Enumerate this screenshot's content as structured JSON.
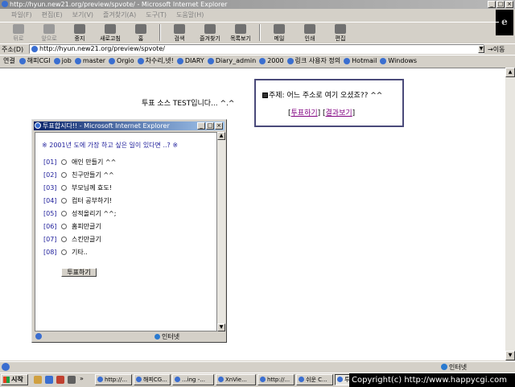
{
  "window": {
    "title": "http://hyun.new21.org/preview/spvote/ - Microsoft Internet Explorer"
  },
  "menu": [
    "파일(F)",
    "편집(E)",
    "보기(V)",
    "즐겨찾기(A)",
    "도구(T)",
    "도움말(H)"
  ],
  "toolbar": [
    {
      "label": "뒤로",
      "disabled": true
    },
    {
      "label": "앞으로",
      "disabled": true
    },
    {
      "label": "중지",
      "disabled": false
    },
    {
      "label": "새로고침",
      "disabled": false
    },
    {
      "label": "홈",
      "disabled": false
    },
    {
      "label": "검색",
      "disabled": false
    },
    {
      "label": "즐겨찾기",
      "disabled": false
    },
    {
      "label": "목록보기",
      "disabled": false
    },
    {
      "label": "메일",
      "disabled": false
    },
    {
      "label": "인쇄",
      "disabled": false
    },
    {
      "label": "편집",
      "disabled": false
    }
  ],
  "address": {
    "label": "주소(D)",
    "url": "http://hyun.new21.org/preview/spvote/",
    "go": "이동"
  },
  "links": {
    "label": "연결",
    "items": [
      "해피CGI",
      "job",
      "master",
      "Orgio",
      "차수리,넷!",
      "DIARY",
      "Diary_admin",
      "2000",
      "링크 사용자 정의",
      "Hotmail",
      "Windows"
    ]
  },
  "page": {
    "test_text": "투표 소스 TEST입니다... ^.^",
    "subject": "주제: 어느 주소로 여기 오셨죠?? ^^",
    "vote_link": "투표하기",
    "result_link": "결과보기"
  },
  "popup": {
    "title": "투표합시다!! - Microsoft Internet Explorer",
    "question": "※ 2001년 도에 가장 하고 싶은 일이 있다면 ..? ※",
    "options": [
      {
        "num": "[01]",
        "text": "애인 만들기 ^^"
      },
      {
        "num": "[02]",
        "text": "친구만들기 ^^"
      },
      {
        "num": "[03]",
        "text": "부모님께 효도!"
      },
      {
        "num": "[04]",
        "text": "컴터 공부하기!"
      },
      {
        "num": "[05]",
        "text": "성적올리기 ^^;"
      },
      {
        "num": "[06]",
        "text": "홈피만글기"
      },
      {
        "num": "[07]",
        "text": "스킨만글기"
      },
      {
        "num": "[08]",
        "text": "기타.."
      }
    ],
    "vote_button": "투표하기",
    "status_zone": "인터넷"
  },
  "status": {
    "zone": "인터넷"
  },
  "taskbar": {
    "start": "시작",
    "tasks": [
      "http://...",
      "해피CG...",
      "...ing -...",
      "XnVie...",
      "http://...",
      "쉬운 C...",
      "투표..."
    ],
    "copyright": "Copyright(c) http://www.happycgi.com"
  }
}
